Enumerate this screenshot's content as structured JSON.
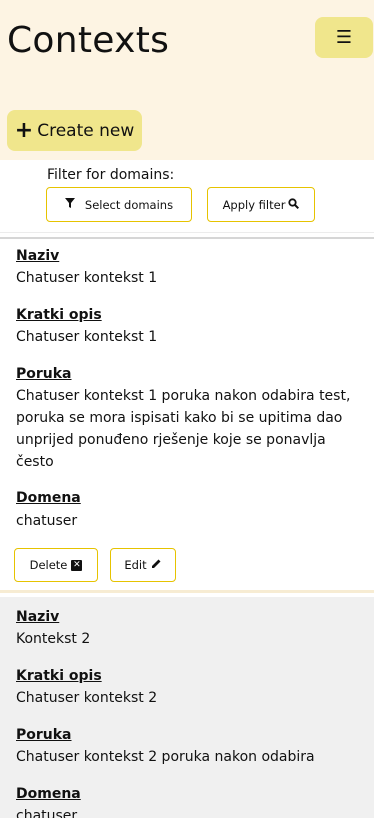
{
  "header": {
    "title": "Contexts",
    "menu_icon": "☰",
    "create_label": "Create new",
    "create_icon": "+"
  },
  "filter": {
    "label": "Filter for domains:",
    "select_label": "Select domains",
    "apply_label": "Apply filter"
  },
  "contexts": [
    {
      "naziv_label": "Naziv",
      "naziv": "Chatuser kontekst 1",
      "opis_label": "Kratki opis",
      "opis": "Chatuser kontekst 1",
      "poruka_label": "Poruka",
      "poruka": "Chatuser kontekst 1 poruka nakon odabira test, poruka se mora ispisati kako bi se upitima dao unprijed ponuđeno rješenje koje se ponavlja često",
      "domena_label": "Domena",
      "domena": "chatuser",
      "delete_label": "Delete",
      "edit_label": "Edit"
    },
    {
      "naziv_label": "Naziv",
      "naziv": "Kontekst 2",
      "opis_label": "Kratki opis",
      "opis": "Chatuser kontekst 2",
      "poruka_label": "Poruka",
      "poruka": "Chatuser kontekst 2 poruka nakon odabira",
      "domena_label": "Domena",
      "domena": "chatuser"
    }
  ],
  "colors": {
    "header_bg": "#fdf4e3",
    "accent_yellow": "#f0e68c",
    "border_yellow": "#e6c300",
    "alt_card_bg": "#f0f0f0"
  }
}
